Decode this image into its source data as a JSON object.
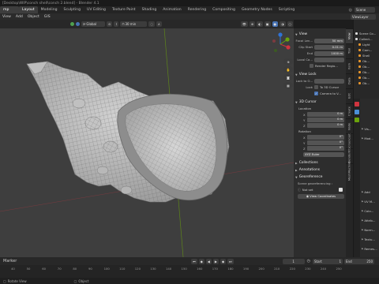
{
  "title_bar": {
    "text": "[Desktop\\WIP\\conch shell\\conch 2.blend] - Blender 4.1"
  },
  "workspaces": [
    "Layout",
    "Modeling",
    "Sculpting",
    "UV Editing",
    "Texture Paint",
    "Shading",
    "Animation",
    "Rendering",
    "Compositing",
    "Geometry Nodes",
    "Scripting"
  ],
  "active_workspace": "Layout",
  "workspace_app_menu": "mp",
  "menu": [
    "View",
    "Add",
    "Object",
    "GIS"
  ],
  "right_header": {
    "scene": "Scene",
    "view_layer": "ViewLayer"
  },
  "viewport_header": {
    "transform": "Global",
    "selector": "30 min"
  },
  "npanel": {
    "view": {
      "header": "View",
      "focal_label": "Focal Len...",
      "focal_value": "50 mm",
      "clip_start_label": "Clip Start",
      "clip_start_value": "0.01 m",
      "end_label": "End",
      "end_value": "1000 m",
      "local_label": "Local Ca...",
      "render_region": "Render Regio..."
    },
    "view_lock": {
      "header": "View Lock",
      "lock_to_label": "Lock to O...",
      "lock_label": "Lock",
      "to_3d_cursor": "To 3D Cursor",
      "camera_to_view": "Camera to V..."
    },
    "cursor": {
      "header": "3D Cursor",
      "location_label": "Location",
      "loc": [
        {
          "axis": "X",
          "value": "0 m"
        },
        {
          "axis": "Y",
          "value": "0 m"
        },
        {
          "axis": "Z",
          "value": "0 m"
        }
      ],
      "rotation_label": "Rotation",
      "rot": [
        {
          "axis": "X",
          "value": "0°"
        },
        {
          "axis": "Y",
          "value": "0°"
        },
        {
          "axis": "Z",
          "value": "0°"
        }
      ],
      "mode": "XYZ Euler"
    },
    "collections": "Collections",
    "annotations": "Annotations",
    "georef": {
      "header": "Georeference",
      "sub": "Scene georeferencing :",
      "status": "Not set",
      "button": "View Coordinates"
    }
  },
  "n_tabs": [
    "View",
    "Tool",
    "Item",
    "Data",
    "Edit",
    "Create",
    "Node",
    "Screencast",
    "BlenderKit",
    "MeshMachine"
  ],
  "active_n_tab": "View",
  "outliner_items": [
    "Scene Co...",
    "Collect...",
    "Light",
    "Cam...",
    "Shell",
    "Ob...",
    "Ob...",
    "Ob...",
    "Ob...",
    "Ob..."
  ],
  "props_sections": [
    "Vis...",
    "Mod...",
    "Add",
    "UV M...",
    "Colo...",
    "Attrib...",
    "Norm...",
    "Textu...",
    "Remes...",
    "Geom...",
    "Custo..."
  ],
  "timeline": {
    "marker_label": "Marker",
    "current_frame": "1",
    "start_label": "Start",
    "start": "1",
    "end_label": "End",
    "end": "250",
    "ticks": [
      "40",
      "50",
      "60",
      "70",
      "80",
      "90",
      "100",
      "110",
      "120",
      "130",
      "140",
      "150",
      "160",
      "170",
      "180",
      "190",
      "200",
      "210",
      "220",
      "230",
      "240",
      "250"
    ]
  },
  "status_bar": {
    "left": "Rotate View",
    "right": "Object"
  },
  "colors": {
    "viewport_bg": "#3e3e3e",
    "panel_bg": "#2d2d2d",
    "accent": "#4772b3",
    "axis_red": "#d0343f",
    "axis_green": "#6ba30b",
    "axis_blue": "#2f72d6"
  }
}
